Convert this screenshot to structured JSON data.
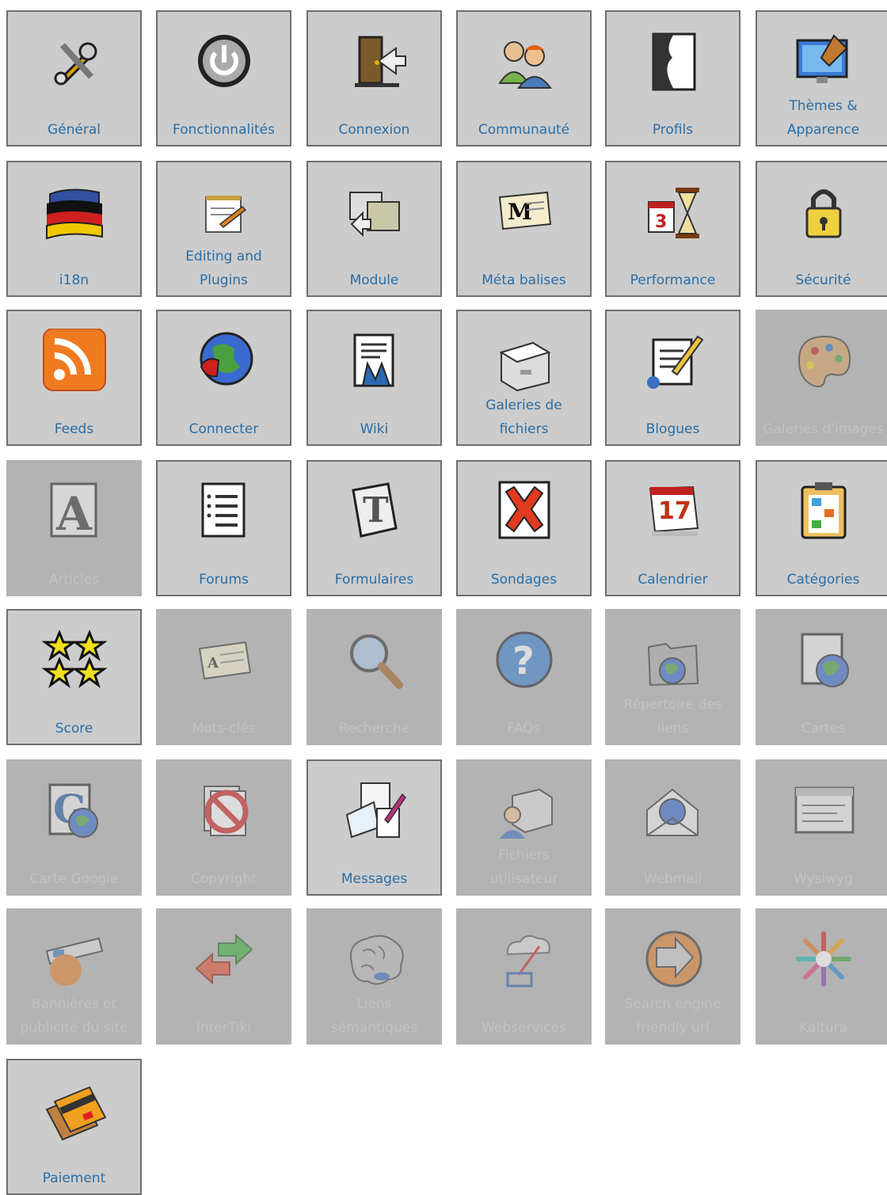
{
  "tiles": [
    {
      "label": "Général",
      "icon": "tools-icon",
      "enabled": true
    },
    {
      "label": "Fonctionnalités",
      "icon": "power-icon",
      "enabled": true
    },
    {
      "label": "Connexion",
      "icon": "door-login-icon",
      "enabled": true
    },
    {
      "label": "Communauté",
      "icon": "people-icon",
      "enabled": true
    },
    {
      "label": "Profils",
      "icon": "profile-icon",
      "enabled": true
    },
    {
      "label": "Thèmes &\nApparence",
      "icon": "theme-paint-icon",
      "enabled": true
    },
    {
      "label": "i18n",
      "icon": "flags-icon",
      "enabled": true
    },
    {
      "label": "Editing and\nPlugins",
      "icon": "notepad-pencil-icon",
      "enabled": true
    },
    {
      "label": "Module",
      "icon": "module-windows-icon",
      "enabled": true
    },
    {
      "label": "Méta balises",
      "icon": "meta-tag-card-icon",
      "enabled": true
    },
    {
      "label": "Performance",
      "icon": "calendar-hourglass-icon",
      "enabled": true
    },
    {
      "label": "Sécurité",
      "icon": "padlock-icon",
      "enabled": true
    },
    {
      "label": "Feeds",
      "icon": "rss-icon",
      "enabled": true
    },
    {
      "label": "Connecter",
      "icon": "globe-plug-icon",
      "enabled": true
    },
    {
      "label": "Wiki",
      "icon": "wiki-document-icon",
      "enabled": true
    },
    {
      "label": "Galeries de\nfichiers",
      "icon": "file-drawer-icon",
      "enabled": true
    },
    {
      "label": "Blogues",
      "icon": "blog-pencil-icon",
      "enabled": true
    },
    {
      "label": "Galeries d'images",
      "icon": "palette-icon",
      "enabled": false
    },
    {
      "label": "Articles",
      "icon": "letter-a-icon",
      "enabled": false
    },
    {
      "label": "Forums",
      "icon": "forum-list-icon",
      "enabled": true
    },
    {
      "label": "Formulaires",
      "icon": "letter-t-icon",
      "enabled": true
    },
    {
      "label": "Sondages",
      "icon": "red-x-icon",
      "enabled": true
    },
    {
      "label": "Calendrier",
      "icon": "calendar-17-icon",
      "enabled": true
    },
    {
      "label": "Catégories",
      "icon": "clipboard-tree-icon",
      "enabled": true
    },
    {
      "label": "Score",
      "icon": "stars-icon",
      "enabled": true
    },
    {
      "label": "Mots-clés",
      "icon": "keyword-card-icon",
      "enabled": false
    },
    {
      "label": "Recherche",
      "icon": "magnifier-icon",
      "enabled": false
    },
    {
      "label": "FAQs",
      "icon": "question-icon",
      "enabled": false
    },
    {
      "label": "Répertoire des\nliens",
      "icon": "folder-globe-icon",
      "enabled": false
    },
    {
      "label": "Cartes",
      "icon": "map-globe-icon",
      "enabled": false
    },
    {
      "label": "Carte Google",
      "icon": "google-globe-icon",
      "enabled": false
    },
    {
      "label": "Copyright",
      "icon": "no-copy-icon",
      "enabled": false
    },
    {
      "label": "Messages",
      "icon": "messages-icon",
      "enabled": true
    },
    {
      "label": "Fichiers\nutilisateur",
      "icon": "user-files-icon",
      "enabled": false
    },
    {
      "label": "Webmail",
      "icon": "envelope-globe-icon",
      "enabled": false
    },
    {
      "label": "Wysiwyg",
      "icon": "editor-window-icon",
      "enabled": false
    },
    {
      "label": "Bannières et\npublicité du site",
      "icon": "banner-icon",
      "enabled": false
    },
    {
      "label": "InterTiki",
      "icon": "exchange-arrows-icon",
      "enabled": false
    },
    {
      "label": "Liens\nsémantiques",
      "icon": "brain-icon",
      "enabled": false
    },
    {
      "label": "Webservices",
      "icon": "cloud-network-icon",
      "enabled": false
    },
    {
      "label": "Search engine\nfriendly url",
      "icon": "arrow-circle-icon",
      "enabled": false
    },
    {
      "label": "Kaltura",
      "icon": "kaltura-flower-icon",
      "enabled": false
    },
    {
      "label": "Paiement",
      "icon": "credit-cards-icon",
      "enabled": true
    }
  ]
}
